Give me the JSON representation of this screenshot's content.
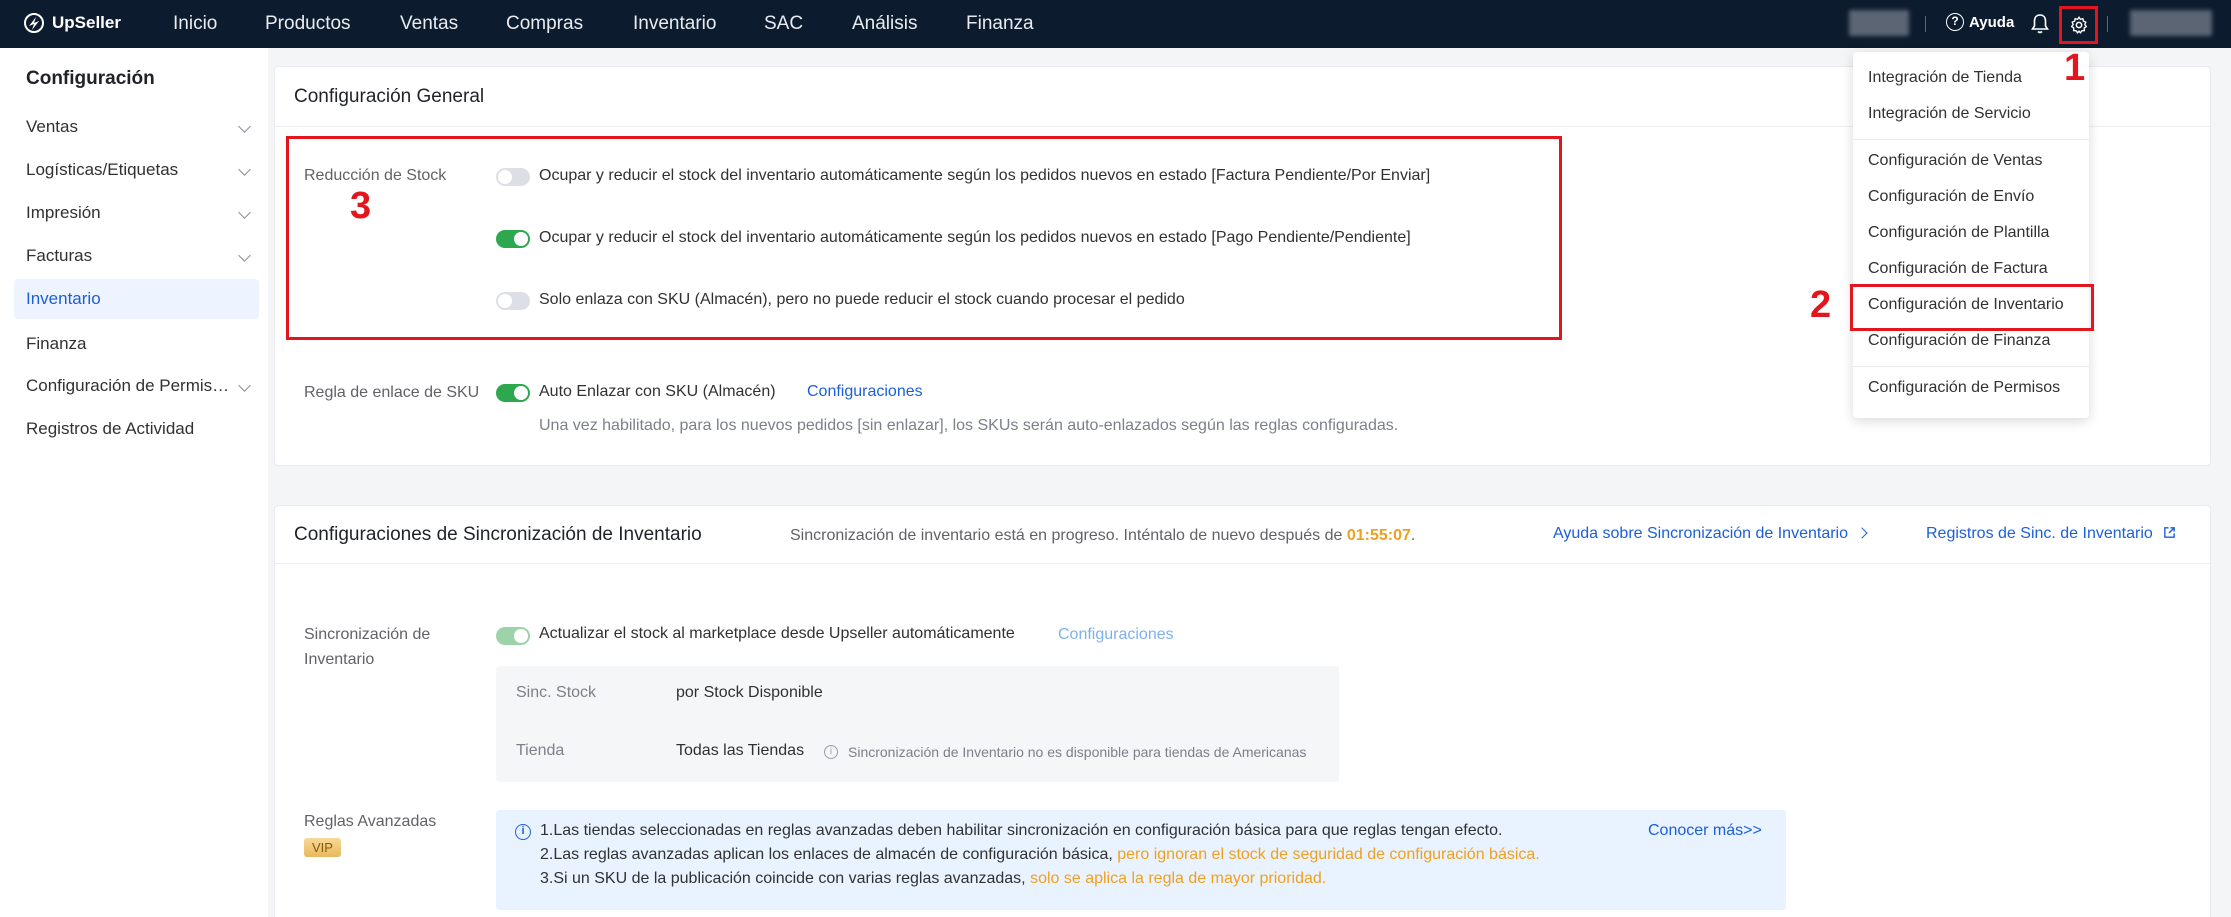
{
  "topbar": {
    "logo": "UpSeller",
    "nav": [
      "Inicio",
      "Productos",
      "Ventas",
      "Compras",
      "Inventario",
      "SAC",
      "Análisis",
      "Finanza"
    ],
    "help": "Ayuda",
    "icons": [
      "help-icon",
      "bell-icon",
      "gear-icon"
    ]
  },
  "sidebar": {
    "title": "Configuración",
    "items": [
      {
        "label": "Ventas",
        "expandable": true
      },
      {
        "label": "Logísticas/Etiquetas",
        "expandable": true
      },
      {
        "label": "Impresión",
        "expandable": true
      },
      {
        "label": "Facturas",
        "expandable": true
      },
      {
        "label": "Inventario",
        "expandable": false,
        "active": true
      },
      {
        "label": "Finanza",
        "expandable": false
      },
      {
        "label": "Configuración de Permis…",
        "expandable": true
      },
      {
        "label": "Registros de Actividad",
        "expandable": false
      }
    ]
  },
  "general": {
    "title": "Configuración General",
    "stock_reduction": {
      "label": "Reducción de Stock",
      "options": [
        {
          "text": "Ocupar y reducir el stock del inventario automáticamente según los pedidos nuevos en estado [Factura Pendiente/Por Enviar]",
          "on": false
        },
        {
          "text": "Ocupar y reducir el stock del inventario automáticamente según los pedidos nuevos en estado [Pago Pendiente/Pendiente]",
          "on": true
        },
        {
          "text": "Solo enlaza con SKU (Almacén), pero no puede reducir el stock cuando procesar el pedido",
          "on": false
        }
      ]
    },
    "sku_link": {
      "label": "Regla de enlace de SKU",
      "toggle_text": "Auto Enlazar con SKU (Almacén)",
      "link": "Configuraciones",
      "note": "Una vez habilitado, para los nuevos pedidos [sin enlazar], los SKUs serán auto-enlazados según las reglas configuradas.",
      "on": true
    }
  },
  "sync": {
    "title": "Configuraciones de Sincronización de Inventario",
    "status_prefix": "Sincronización de inventario está en progreso. Inténtalo de nuevo después de ",
    "countdown": "01:55:07",
    "status_suffix": ".",
    "help_link": "Ayuda sobre Sincronización de Inventario",
    "logs_link": "Registros de Sinc. de Inventario",
    "inv_sync_label_1": "Sincronización de",
    "inv_sync_label_2": "Inventario",
    "auto_text": "Actualizar el stock al marketplace desde Upseller automáticamente",
    "auto_link": "Configuraciones",
    "rows": [
      {
        "key": "Sinc. Stock",
        "value": "por Stock Disponible",
        "note": ""
      },
      {
        "key": "Tienda",
        "value": "Todas las Tiendas",
        "note": "Sincronización de Inventario no es disponible para tiendas de Americanas"
      }
    ],
    "advanced_label": "Reglas Avanzadas",
    "vip": "VIP",
    "info": {
      "line1": "1.Las tiendas seleccionadas en reglas avanzadas deben habilitar sincronización en configuración básica para que reglas tengan efecto.",
      "line2_a": "2.Las reglas avanzadas aplican los enlaces de almacén de configuración básica, ",
      "line2_b": "pero ignoran el stock de seguridad de configuración básica.",
      "line3_a": "3.Si un SKU de la publicación coincide con varias reglas avanzadas, ",
      "line3_b": "solo se aplica la regla de mayor prioridad.",
      "more": "Conocer más>>"
    }
  },
  "dropdown": {
    "items": [
      "Integración de Tienda",
      "Integración de Servicio",
      "Configuración de Ventas",
      "Configuración de Envío",
      "Configuración de Plantilla",
      "Configuración de Factura",
      "Configuración de Inventario",
      "Configuración de Finanza",
      "Configuración de Permisos"
    ]
  },
  "annotations": [
    "1",
    "2",
    "3"
  ],
  "colors": {
    "accent": "#1c5fd9",
    "toggle_on": "#2ea84f",
    "highlight": "#e3161e",
    "countdown": "#f0a020",
    "topbar": "#0d1b2e"
  }
}
